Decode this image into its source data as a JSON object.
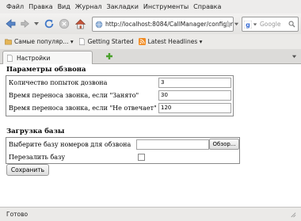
{
  "menu": [
    "Файл",
    "Правка",
    "Вид",
    "Журнал",
    "Закладки",
    "Инструменты",
    "Справка"
  ],
  "nav": {
    "url": "http://localhost:8084/CallManager/configuration...",
    "search_placeholder": "Google",
    "search_engine_icon": "google-icon"
  },
  "bookmarks": [
    {
      "label": "Самые популяр... ▾",
      "icon": "folder-icon"
    },
    {
      "label": "Getting Started",
      "icon": "page-icon"
    },
    {
      "label": "Latest Headlines ▾",
      "icon": "rss-icon"
    }
  ],
  "tabs": [
    {
      "label": "Настройки"
    }
  ],
  "section1": {
    "title": "Параметры обзвона",
    "fields": [
      {
        "label": "Количество попыток дозвона",
        "value": "3"
      },
      {
        "label": "Время переноса звонка, если \"Занято\"",
        "value": "30"
      },
      {
        "label": "Время переноса звонка, если \"Не отвечает\"",
        "value": "120"
      }
    ]
  },
  "section2": {
    "title": "Загрузка базы",
    "file_label": "Выберите базу номеров для обзвона",
    "browse_label": "Обзор...",
    "overwrite_label": "Перезалить базу"
  },
  "save_label": "Сохранить",
  "status": "Готово"
}
